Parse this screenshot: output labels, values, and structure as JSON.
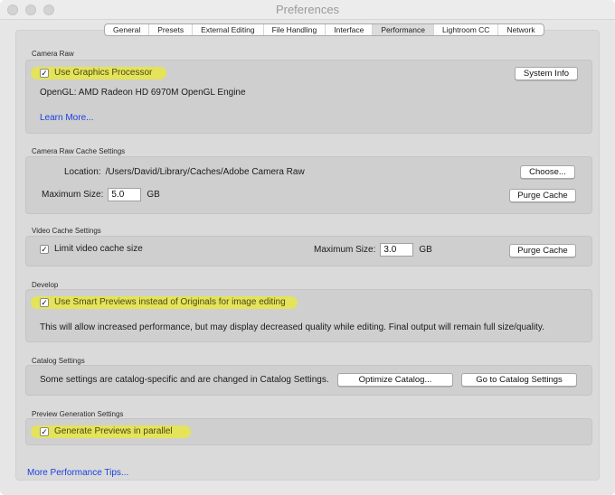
{
  "window": {
    "title": "Preferences",
    "traffic_lights": [
      "close",
      "minimize",
      "zoom"
    ]
  },
  "tabs": [
    {
      "label": "General",
      "active": false
    },
    {
      "label": "Presets",
      "active": false
    },
    {
      "label": "External Editing",
      "active": false
    },
    {
      "label": "File Handling",
      "active": false
    },
    {
      "label": "Interface",
      "active": false
    },
    {
      "label": "Performance",
      "active": true
    },
    {
      "label": "Lightroom CC",
      "active": false
    },
    {
      "label": "Network",
      "active": false
    }
  ],
  "camera_raw": {
    "section_label": "Camera Raw",
    "use_gpu_label": "Use Graphics Processor",
    "use_gpu_checked": true,
    "system_info_button": "System Info",
    "opengl_info": "OpenGL: AMD Radeon HD 6970M OpenGL Engine",
    "learn_more_link": "Learn More..."
  },
  "camera_raw_cache": {
    "section_label": "Camera Raw Cache Settings",
    "location_label": "Location:",
    "location_value": "/Users/David/Library/Caches/Adobe Camera Raw",
    "choose_button": "Choose...",
    "max_size_label": "Maximum Size:",
    "max_size_value": "5.0",
    "max_size_unit": "GB",
    "purge_button": "Purge Cache"
  },
  "video_cache": {
    "section_label": "Video Cache Settings",
    "limit_label": "Limit video cache size",
    "limit_checked": true,
    "max_size_label": "Maximum Size:",
    "max_size_value": "3.0",
    "max_size_unit": "GB",
    "purge_button": "Purge Cache"
  },
  "develop": {
    "section_label": "Develop",
    "smart_previews_label": "Use Smart Previews instead of Originals for image editing",
    "smart_previews_checked": true,
    "note": "This will allow increased performance, but may display decreased quality while editing. Final output will remain full size/quality."
  },
  "catalog": {
    "section_label": "Catalog Settings",
    "note": "Some settings are catalog-specific and are changed in Catalog Settings.",
    "optimize_button": "Optimize Catalog...",
    "goto_button": "Go to Catalog Settings"
  },
  "preview_generation": {
    "section_label": "Preview Generation Settings",
    "parallel_label": "Generate Previews in parallel",
    "parallel_checked": true
  },
  "footer": {
    "more_tips_link": "More Performance Tips..."
  },
  "colors": {
    "highlight": "#e4e35a",
    "link": "#1a3fe0"
  }
}
